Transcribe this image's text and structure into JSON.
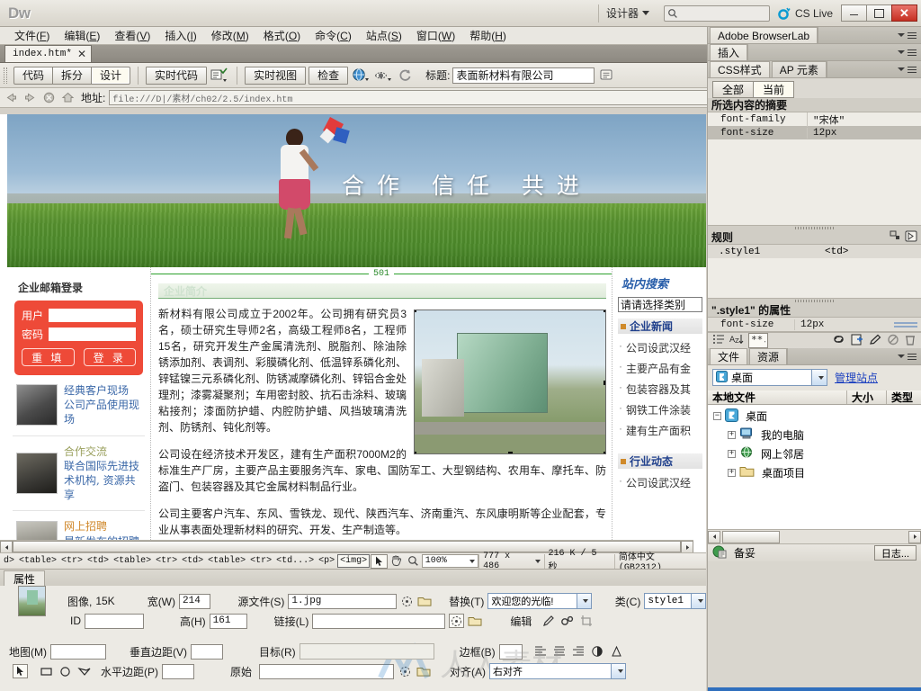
{
  "app": {
    "logo": "Dw",
    "workspace_switcher": "设计器",
    "search_placeholder": "",
    "cs_live": "CS Live",
    "window_buttons": {
      "minimize": "minimize-icon",
      "restore": "restore-icon",
      "close": "✕"
    }
  },
  "menubar": {
    "items": [
      {
        "label": "文件",
        "accel": "F"
      },
      {
        "label": "编辑",
        "accel": "E"
      },
      {
        "label": "查看",
        "accel": "V"
      },
      {
        "label": "插入",
        "accel": "I"
      },
      {
        "label": "修改",
        "accel": "M"
      },
      {
        "label": "格式",
        "accel": "O"
      },
      {
        "label": "命令",
        "accel": "C"
      },
      {
        "label": "站点",
        "accel": "S"
      },
      {
        "label": "窗口",
        "accel": "W"
      },
      {
        "label": "帮助",
        "accel": "H"
      }
    ]
  },
  "document": {
    "tab_label": "index.htm*",
    "tab_close": "✕",
    "full_path": "D:\\素材\\ch02\\2.5\\index.htm"
  },
  "doc_toolbar": {
    "view_buttons": [
      {
        "label": "代码",
        "active": false
      },
      {
        "label": "拆分",
        "active": false
      },
      {
        "label": "设计",
        "active": true
      }
    ],
    "live_code": "实时代码",
    "live_view": "实时视图",
    "inspect": "检查",
    "title_label": "标题:",
    "title_value": "表面新材料有限公司",
    "icons": [
      "back-icon",
      "forward-icon",
      "refresh-icon",
      "globe-icon",
      "eye-icon",
      "reload-icon",
      "file-management-icon"
    ]
  },
  "address_bar": {
    "label": "地址:",
    "value": "file:///D|/素材/ch02/2.5/index.htm"
  },
  "page": {
    "banner": {
      "slogan": "合作  信任  共进"
    },
    "left_column": {
      "mail_title": "企业邮箱登录",
      "user_label": "用户",
      "pass_label": "密码",
      "user_value": "",
      "pass_value": "",
      "reset_button": "重 填",
      "login_button": "登 录",
      "promos": [
        {
          "line1": "经典客户现场",
          "line2": "公司产品使用现场",
          "style": "plain"
        },
        {
          "line1": "合作交流",
          "line2": "联合国际先进技术机构, 资源共享",
          "style": "olive"
        },
        {
          "line1": "网上招聘",
          "line2": "最新发布的招聘信息",
          "style": "orange"
        }
      ]
    },
    "mid_column": {
      "cell_width_marker": "501",
      "section_title": "企业简介",
      "paragraphs": [
        "新材料有限公司成立于2002年。公司拥有研究员3名，硕士研究生导师2名，高级工程师8名，工程师15名，研究开发生产金属清洗剂、脱脂剂、除油除锈添加剂、表调剂、彩膜磷化剂、低温锌系磷化剂、锌锰镍三元系磷化剂、防锈减摩磷化剂、锌铝合金处理剂；漆雾凝聚剂；车用密封胶、抗石击涂料、玻璃粘接剂；漆面防护蜡、内腔防护蜡、风挡玻璃清洗剂、防锈剂、钝化剂等。",
        "公司设在经济技术开发区，建有生产面积7000M2的标准生产厂房，主要产品主要服务汽车、家电、国防军工、大型钢结构、农用车、摩托车、防盗门、包装容器及其它金属材料制品行业。",
        "公司主要客户汽车、东风、雪铁龙、现代、陕西汽车、济南重汽、东风康明斯等企业配套，专业从事表面处理新材料的研究、开发、生产制造等。"
      ]
    },
    "right_column": {
      "search_title": "站内搜索",
      "category_select": "请请选择类别",
      "news_heading": "企业新闻",
      "news_items": [
        "公司设武汉经",
        "主要产品有金",
        "包装容器及其",
        "钢铁工件涂装",
        "建有生产面积"
      ],
      "trends_heading": "行业动态",
      "trends_items": [
        "公司设武汉经"
      ]
    }
  },
  "tag_selector": {
    "tags": [
      "d>",
      "<table>",
      "<tr>",
      "<td>",
      "<table>",
      "<tr>",
      "<td>",
      "<table>",
      "<tr>",
      "<td...>",
      "<p>"
    ],
    "selected_tag": "<img>"
  },
  "status_bar": {
    "tools": [
      "select-tool-icon",
      "hand-tool-icon",
      "zoom-tool-icon"
    ],
    "zoom": "100%",
    "window_size": "777 x 486",
    "doc_size": "216 K / 5 秒",
    "encoding": "简体中文 (GB2312)"
  },
  "properties": {
    "tab_label": "属性",
    "image_label": "图像,",
    "image_size": "15K",
    "id_label": "ID",
    "id_value": "",
    "width_label": "宽(W)",
    "width_value": "214",
    "height_label": "高(H)",
    "height_value": "161",
    "src_label": "源文件(S)",
    "src_value": "1.jpg",
    "link_label": "链接(L)",
    "link_value": "",
    "alt_label": "替换(T)",
    "alt_value": "欢迎您的光临!",
    "edit_label": "编辑",
    "class_label": "类(C)",
    "class_value": "style1",
    "map_label": "地图(M)",
    "map_value": "",
    "vspace_label": "垂直边距(V)",
    "vspace_value": "",
    "hspace_label": "水平边距(P)",
    "hspace_value": "",
    "target_label": "目标(R)",
    "target_value": "",
    "original_label": "原始",
    "original_value": "",
    "border_label": "边框(B)",
    "border_value": "",
    "align_label": "对齐(A)",
    "align_value": "右对齐",
    "hotspot_icons": [
      "pointer-hotspot-icon",
      "rect-hotspot-icon",
      "oval-hotspot-icon",
      "poly-hotspot-icon"
    ],
    "align_icons": [
      "align-left-icon",
      "align-center-icon",
      "align-right-icon",
      "brightness-icon",
      "sharpen-icon"
    ],
    "edit_icons": [
      "pencil-icon",
      "optimize-icon",
      "crop-icon"
    ]
  },
  "dock": {
    "browserlab_tab": "Adobe BrowserLab",
    "insert_tab": "插入",
    "css_tab": "CSS样式",
    "ap_tab": "AP 元素",
    "css": {
      "all_button": "全部",
      "current_button": "当前",
      "summary_heading": "所选内容的摘要",
      "summary_rows": [
        {
          "prop": "font-family",
          "value": "\"宋体\"",
          "highlight": false
        },
        {
          "prop": "font-size",
          "value": "12px",
          "highlight": true
        }
      ],
      "rules_heading": "规则",
      "rules_rows": [
        {
          "selector": ".style1",
          "context": "<td>"
        }
      ],
      "props_heading": "\".style1\" 的属性",
      "props_rows": [
        {
          "prop": "font-size",
          "value": "12px"
        }
      ],
      "toolbar_icons": [
        "category-view-icon",
        "list-view-icon",
        "set-props-icon",
        "attach-stylesheet-icon",
        "new-rule-icon",
        "edit-rule-icon",
        "disable-icon",
        "delete-icon"
      ]
    },
    "files": {
      "files_tab": "文件",
      "assets_tab": "资源",
      "site_combo": "桌面",
      "manage_sites": "管理站点",
      "col_local": "本地文件",
      "col_size": "大小",
      "col_type": "类型",
      "tree": [
        {
          "label": "桌面",
          "depth": 0,
          "expander": "−",
          "icon": "desktop-icon"
        },
        {
          "label": "我的电脑",
          "depth": 1,
          "expander": "+",
          "icon": "computer-icon"
        },
        {
          "label": "网上邻居",
          "depth": 1,
          "expander": "+",
          "icon": "network-icon"
        },
        {
          "label": "桌面项目",
          "depth": 1,
          "expander": "+",
          "icon": "folder-icon"
        }
      ],
      "status": "备妥",
      "log_button": "日志..."
    }
  },
  "colors": {
    "accent_red": "#ee4a38",
    "accent_blue": "#2a5faa",
    "green_rule": "#2ea12e",
    "chrome": "#d9d6ce"
  }
}
